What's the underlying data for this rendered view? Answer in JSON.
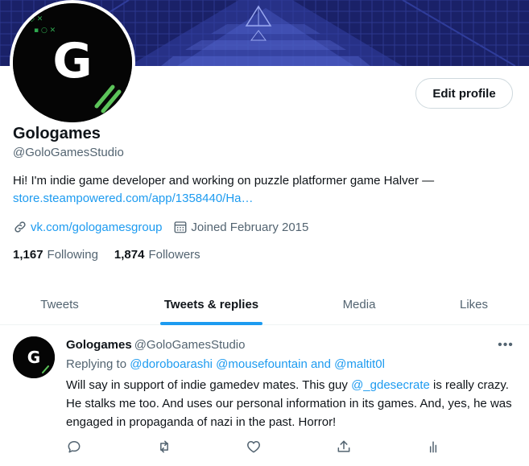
{
  "profile": {
    "name": "Gologames",
    "handle": "@GoloGamesStudio",
    "avatar_letter": "G",
    "edit_label": "Edit profile",
    "bio_text": "Hi! I'm indie game developer and working on puzzle platformer game Halver —",
    "bio_link": "store.steampowered.com/app/1358440/Ha…",
    "website": "vk.com/gologamesgroup",
    "joined": "Joined February 2015",
    "following_count": "1,167",
    "following_label": "Following",
    "followers_count": "1,874",
    "followers_label": "Followers"
  },
  "tabs": [
    {
      "label": "Tweets",
      "active": false
    },
    {
      "label": "Tweets & replies",
      "active": true
    },
    {
      "label": "Media",
      "active": false
    },
    {
      "label": "Likes",
      "active": false
    }
  ],
  "tweet": {
    "author": "Gologames",
    "handle": "@GoloGamesStudio",
    "avatar_letter": "G",
    "replying_prefix": "Replying to",
    "replying_to": "@doroboarashi @mousefountain and @maltit0l",
    "text_before": "Will say in support of indie gamedev mates. This guy ",
    "mention": "@_gdesecrate",
    "text_after": " is really crazy. He stalks me too. And uses our personal information in its games. And, yes, he was engaged in propaganda of nazi in the past. Horror!",
    "more_label": "•••"
  },
  "icons": {
    "link": "link-icon",
    "calendar": "calendar-icon",
    "reply": "reply-icon",
    "retweet": "retweet-icon",
    "like": "like-icon",
    "share": "share-icon",
    "analytics": "analytics-icon"
  },
  "colors": {
    "accent": "#1d9bf0",
    "text": "#0f1419",
    "muted": "#536471",
    "banner": "#1c2470"
  }
}
